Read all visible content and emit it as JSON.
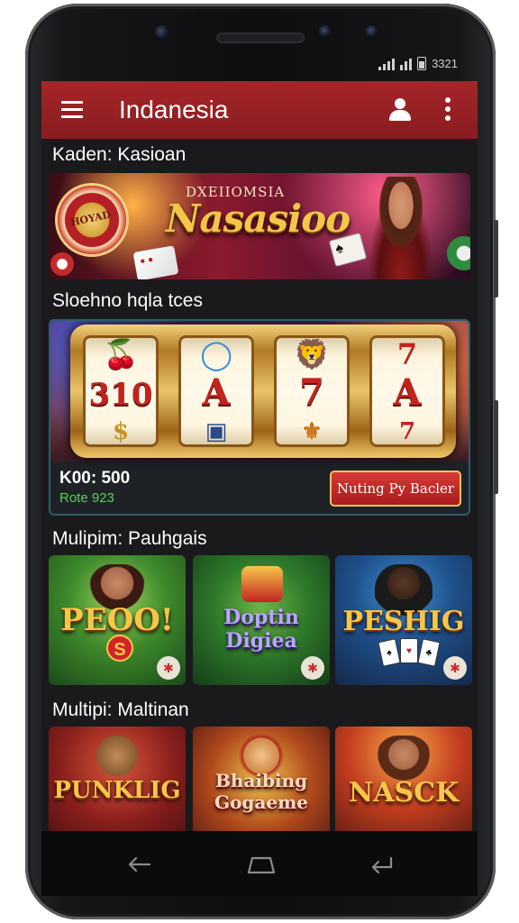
{
  "status": {
    "time": "3321"
  },
  "appbar": {
    "title": "Indanesia"
  },
  "sections": {
    "featured": "Kaden: Kasioan",
    "slots": "Sloehno hqla tces",
    "multiplayer": "Mulipim: Pauhgais",
    "more": "Multipi: Maltinan"
  },
  "hero": {
    "subtitle": "DXEIIOMSIA",
    "title": "Nasasioo",
    "chip_text": "HOYAD"
  },
  "slot": {
    "reels": [
      {
        "top": "🍒",
        "mid": "310",
        "bot": "$"
      },
      {
        "top": "◯",
        "mid": "A",
        "bot": "▣"
      },
      {
        "top": "🦁",
        "mid": "7",
        "bot": "⚜"
      },
      {
        "top": "7",
        "mid": "A",
        "bot": "7"
      }
    ],
    "value": "K00: 500",
    "rate": "Rote 923",
    "button": "Nuting Py Bacler"
  },
  "games_row1": [
    {
      "title": "PEOO!",
      "badge": "S"
    },
    {
      "title": "Doptin Digiea"
    },
    {
      "title": "PESHIG"
    }
  ],
  "games_row2": [
    {
      "title": "PUNKLIG"
    },
    {
      "title": "Bhaibing Gogaeme"
    },
    {
      "title": "NASCK"
    }
  ],
  "colors": {
    "appbar": "#a52629",
    "accent_gold": "#f6c64a",
    "rate_green": "#59d05c"
  },
  "icons": {
    "menu": "menu-icon",
    "user": "user-icon",
    "more": "more-vertical-icon",
    "back": "back-icon",
    "home": "home-icon",
    "recent": "recent-apps-icon"
  }
}
